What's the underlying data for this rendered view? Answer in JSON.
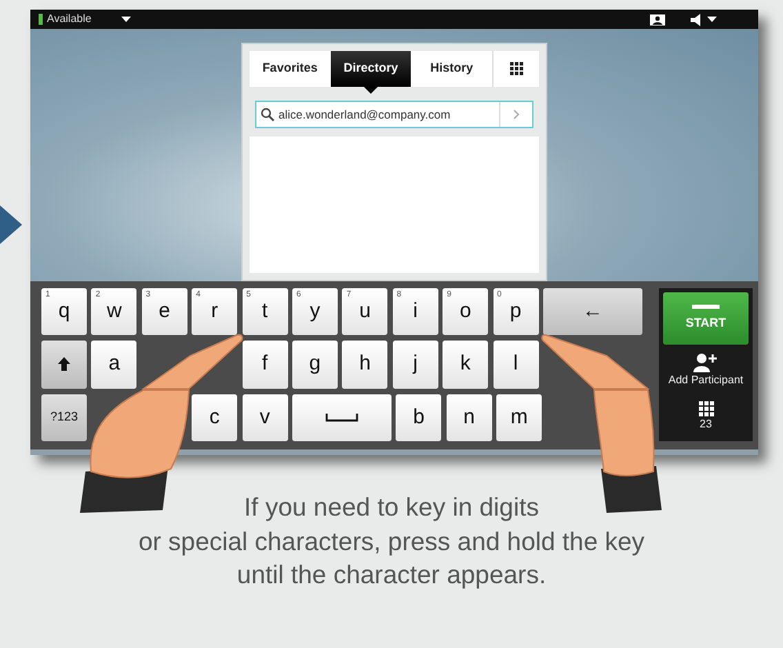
{
  "status_bar": {
    "presence": "Available"
  },
  "tabs": [
    {
      "kind": "text",
      "label": "Favorites",
      "selected": false
    },
    {
      "kind": "text",
      "label": "Directory",
      "selected": true
    },
    {
      "kind": "text",
      "label": "History",
      "selected": false
    },
    {
      "kind": "keypad",
      "selected": false
    }
  ],
  "search": {
    "value": "alice.wonderland@company.com"
  },
  "keyboard": {
    "key_rows": [
      {
        "keys": [
          {
            "kind": "key",
            "label": "q",
            "digit": "1"
          },
          {
            "kind": "key",
            "label": "w",
            "digit": "2"
          },
          {
            "kind": "key",
            "label": "e",
            "digit": "3"
          },
          {
            "kind": "key",
            "label": "r",
            "digit": "4"
          },
          {
            "kind": "key",
            "label": "t",
            "digit": "5"
          },
          {
            "kind": "key",
            "label": "y",
            "digit": "6"
          },
          {
            "kind": "key",
            "label": "u",
            "digit": "7"
          },
          {
            "kind": "key",
            "label": "i",
            "digit": "8"
          },
          {
            "kind": "key",
            "label": "o",
            "digit": "9"
          },
          {
            "kind": "key",
            "label": "p",
            "digit": "0"
          },
          {
            "kind": "backspace",
            "label": "←"
          }
        ]
      },
      {
        "keys": [
          {
            "kind": "shift"
          },
          {
            "kind": "key",
            "label": "a"
          },
          {
            "kind": "blank"
          },
          {
            "kind": "blank"
          },
          {
            "kind": "key",
            "label": "f"
          },
          {
            "kind": "key",
            "label": "g"
          },
          {
            "kind": "key",
            "label": "h"
          },
          {
            "kind": "key",
            "label": "j"
          },
          {
            "kind": "key",
            "label": "k"
          },
          {
            "kind": "key",
            "label": "l"
          },
          {
            "kind": "blank"
          },
          {
            "kind": "blank"
          }
        ]
      },
      {
        "keys": [
          {
            "kind": "mode",
            "label": "?123"
          },
          {
            "kind": "blank"
          },
          {
            "kind": "blank"
          },
          {
            "kind": "key",
            "label": "c"
          },
          {
            "kind": "key",
            "label": "v"
          },
          {
            "kind": "space"
          },
          {
            "kind": "key",
            "label": "b"
          },
          {
            "kind": "key",
            "label": "n"
          },
          {
            "kind": "key",
            "label": "m"
          },
          {
            "kind": "blank"
          }
        ]
      }
    ]
  },
  "side_panel": [
    {
      "kind": "start",
      "label": "START"
    },
    {
      "kind": "add",
      "label": "Add Participant"
    },
    {
      "kind": "keypad",
      "label": "23"
    }
  ],
  "caption_lines": [
    "If you need to key in digits",
    "or special characters, press and hold the key",
    "until the character appears."
  ]
}
